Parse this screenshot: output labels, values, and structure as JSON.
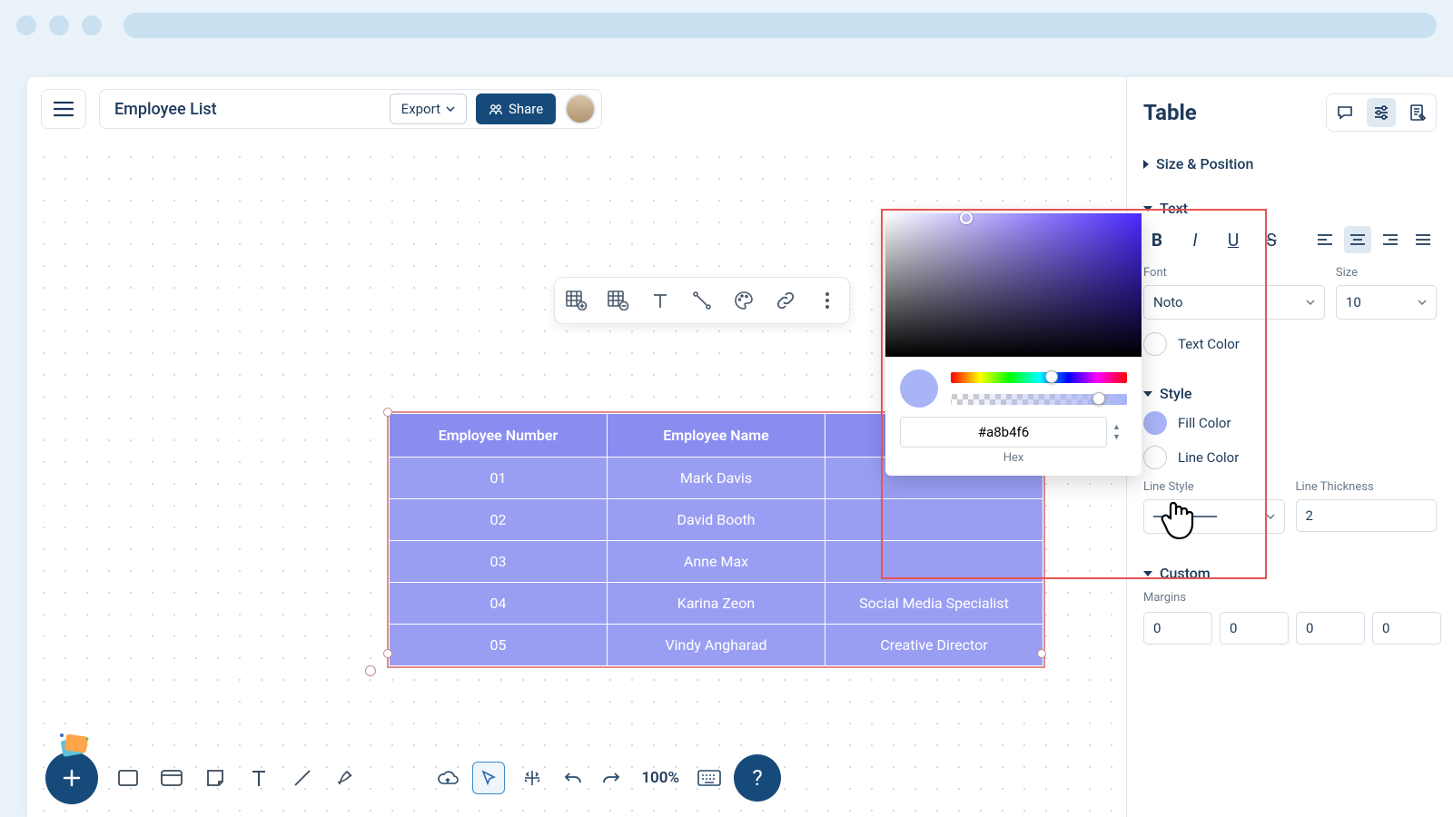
{
  "title": "Employee List",
  "export_label": "Export",
  "share_label": "Share",
  "sidebar": {
    "title": "Table",
    "sections": {
      "size_position": "Size & Position",
      "text": "Text",
      "style": "Style",
      "custom": "Custom"
    },
    "font_label": "Font",
    "size_label": "Size",
    "font_value": "Noto",
    "size_value": "10",
    "text_color": "Text Color",
    "fill_color": "Fill Color",
    "line_color": "Line Color",
    "line_style": "Line Style",
    "line_thickness": "Line Thickness",
    "line_thickness_value": "2",
    "margins": "Margins",
    "margin_values": [
      "0",
      "0",
      "0",
      "0"
    ]
  },
  "color_picker": {
    "hex": "#a8b4f6",
    "hex_label": "Hex",
    "fill_swatch": "#a8b4f6"
  },
  "table": {
    "headers": [
      "Employee Number",
      "Employee Name",
      ""
    ],
    "rows": [
      [
        "01",
        "Mark Davis",
        ""
      ],
      [
        "02",
        "David Booth",
        ""
      ],
      [
        "03",
        "Anne Max",
        ""
      ],
      [
        "04",
        "Karina Zeon",
        "Social Media Specialist"
      ],
      [
        "05",
        "Vindy Angharad",
        "Creative Director"
      ]
    ]
  },
  "zoom": "100%"
}
